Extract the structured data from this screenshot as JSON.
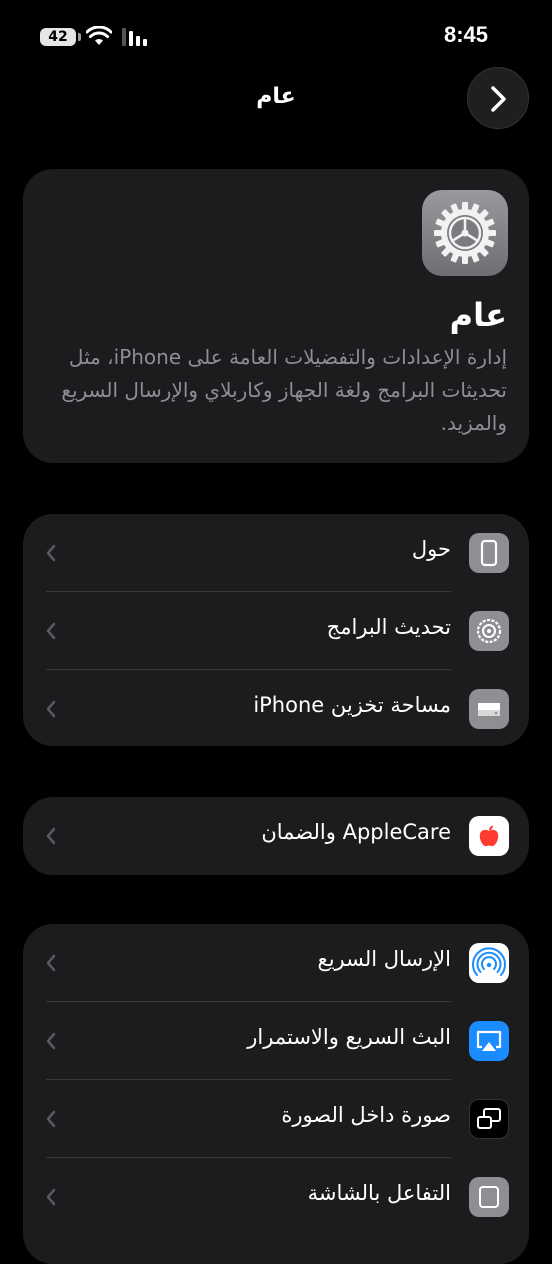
{
  "status_bar": {
    "battery": "42",
    "time": "8:45"
  },
  "nav": {
    "title": "عام"
  },
  "header": {
    "title": "عام",
    "description": "إدارة الإعدادات والتفضيلات العامة على iPhone، مثل تحديثات البرامج ولغة الجهاز وكاربلاي والإرسال السريع والمزيد."
  },
  "groups": {
    "device": [
      {
        "label": "حول",
        "icon": "phone-icon"
      },
      {
        "label": "تحديث البرامج",
        "icon": "gear-update-icon"
      },
      {
        "label": "مساحة تخزين iPhone",
        "icon": "storage-icon"
      }
    ],
    "applecare": [
      {
        "label": "AppleCare والضمان",
        "icon": "apple-icon"
      }
    ],
    "connectivity": [
      {
        "label": "الإرسال السريع",
        "icon": "airdrop-icon"
      },
      {
        "label": "البث السريع والاستمرار",
        "icon": "airplay-icon"
      },
      {
        "label": "صورة داخل الصورة",
        "icon": "pip-icon"
      },
      {
        "label": "التفاعل بالشاشة",
        "icon": "screen-icon"
      }
    ]
  },
  "colors": {
    "background": "#000000",
    "card": "#1c1c1e",
    "secondary_text": "#8e8e93",
    "separator": "#38383a",
    "airplay_blue": "#1a8cff",
    "apple_red": "#ff3b30"
  }
}
